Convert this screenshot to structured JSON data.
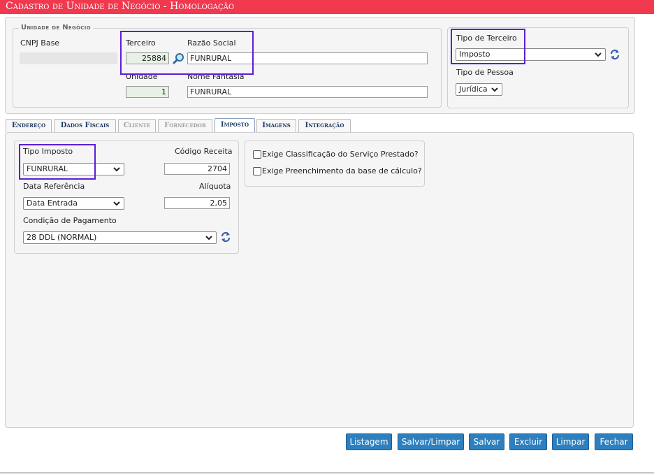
{
  "title": "Cadastro de Unidade de Negócio  - Homologação",
  "unidade_negocio": {
    "legend": "Unidade de Negócio",
    "cnpj_label": "CNPJ Base",
    "cnpj_value": "",
    "terceiro_label": "Terceiro",
    "terceiro_value": "25884",
    "razao_label": "Razão Social",
    "razao_value": "FUNRURAL",
    "unidade_label": "Unidade",
    "unidade_value": "1",
    "fantasia_label": "Nome Fantasia",
    "fantasia_value": "FUNRURAL"
  },
  "tipo_terceiro": {
    "label": "Tipo de Terceiro",
    "value": "Imposto",
    "pessoa_label": "Tipo de Pessoa",
    "pessoa_value": "Jurídica"
  },
  "tabs": [
    {
      "label": "Endereço",
      "state": "normal"
    },
    {
      "label": "Dados Fiscais",
      "state": "normal"
    },
    {
      "label": "Cliente",
      "state": "disabled"
    },
    {
      "label": "Fornecedor",
      "state": "disabled"
    },
    {
      "label": "Imposto",
      "state": "active"
    },
    {
      "label": "Imagens",
      "state": "normal"
    },
    {
      "label": "Integração",
      "state": "normal"
    }
  ],
  "imposto": {
    "tipo_label": "Tipo Imposto",
    "tipo_value": "FUNRURAL",
    "codigo_label": "Código Receita",
    "codigo_value": "2704",
    "data_ref_label": "Data Referência",
    "data_ref_value": "Data Entrada",
    "aliquota_label": "Alíquota",
    "aliquota_value": "2,05",
    "condicao_label": "Condição de Pagamento",
    "condicao_value": "28 DDL (NORMAL)",
    "exige_classificacao": "Exige Classificação do Serviço Prestado?",
    "exige_preenchimento": "Exige Preenchimento da base de cálculo?"
  },
  "buttons": {
    "listagem": "Listagem",
    "salvar_limpar": "Salvar/Limpar",
    "salvar": "Salvar",
    "excluir": "Excluir",
    "limpar": "Limpar",
    "fechar": "Fechar"
  },
  "colors": {
    "title_bar": "#f0384f",
    "highlight": "#5b1fd6",
    "button": "#2e7fbd"
  }
}
